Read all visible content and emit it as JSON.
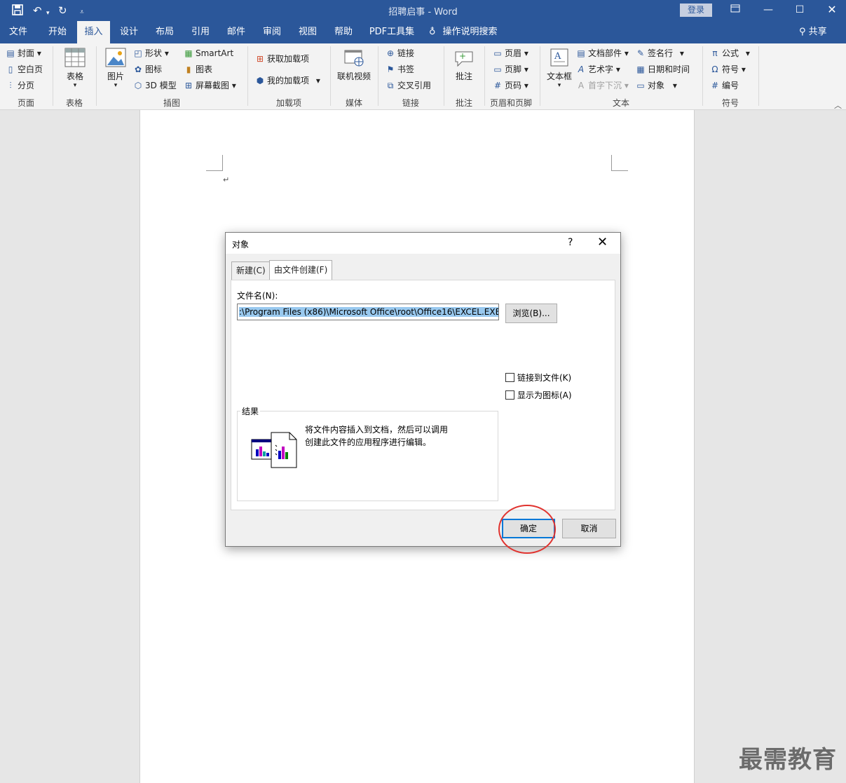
{
  "window": {
    "doc_title": "招聘启事",
    "app_name": "Word",
    "login_label": "登录",
    "quick_access": [
      "save-icon",
      "undo-icon",
      "redo-icon",
      "customize-icon"
    ]
  },
  "menu": {
    "tabs": [
      "文件",
      "开始",
      "插入",
      "设计",
      "布局",
      "引用",
      "邮件",
      "审阅",
      "视图",
      "帮助",
      "PDF工具集"
    ],
    "active_tab": "插入",
    "tell_me": "操作说明搜索",
    "share": "共享"
  },
  "ribbon": {
    "page_group": {
      "label": "页面",
      "cover": "封面",
      "blank": "空白页",
      "break": "分页"
    },
    "table_group": {
      "label": "表格",
      "table": "表格"
    },
    "illus_group": {
      "label": "插图",
      "picture": "图片",
      "shapes": "形状",
      "icons": "图标",
      "model3d": "3D 模型",
      "smartart": "SmartArt",
      "chart": "图表",
      "screenshot": "屏幕截图"
    },
    "addin_group": {
      "label": "加载项",
      "get": "获取加载项",
      "mine": "我的加载项"
    },
    "media_group": {
      "label": "媒体",
      "video": "联机视频"
    },
    "link_group": {
      "label": "链接",
      "link": "链接",
      "bookmark": "书签",
      "crossref": "交叉引用"
    },
    "comment_group": {
      "label": "批注",
      "comment": "批注"
    },
    "hf_group": {
      "label": "页眉和页脚",
      "header": "页眉",
      "footer": "页脚",
      "pagenum": "页码"
    },
    "text_group": {
      "label": "文本",
      "textbox": "文本框",
      "parts": "文档部件",
      "wordart": "艺术字",
      "dropcap": "首字下沉",
      "signature": "签名行",
      "datetime": "日期和时间",
      "object": "对象"
    },
    "symbol_group": {
      "label": "符号",
      "equation": "公式",
      "symbol": "符号",
      "number": "编号"
    }
  },
  "dialog": {
    "title": "对象",
    "help": "?",
    "tabs": [
      "新建(C)",
      "由文件创建(F)"
    ],
    "filename_label": "文件名(N):",
    "filename_value": ":\\Program Files (x86)\\Microsoft Office\\root\\Office16\\EXCEL.EXE",
    "browse": "浏览(B)...",
    "link_to_file": "链接到文件(K)",
    "display_as_icon": "显示为图标(A)",
    "result_label": "结果",
    "result_text": "将文件内容插入到文档，然后可以调用创建此文件的应用程序进行编辑。",
    "ok": "确定",
    "cancel": "取消"
  },
  "watermark": "最需教育"
}
